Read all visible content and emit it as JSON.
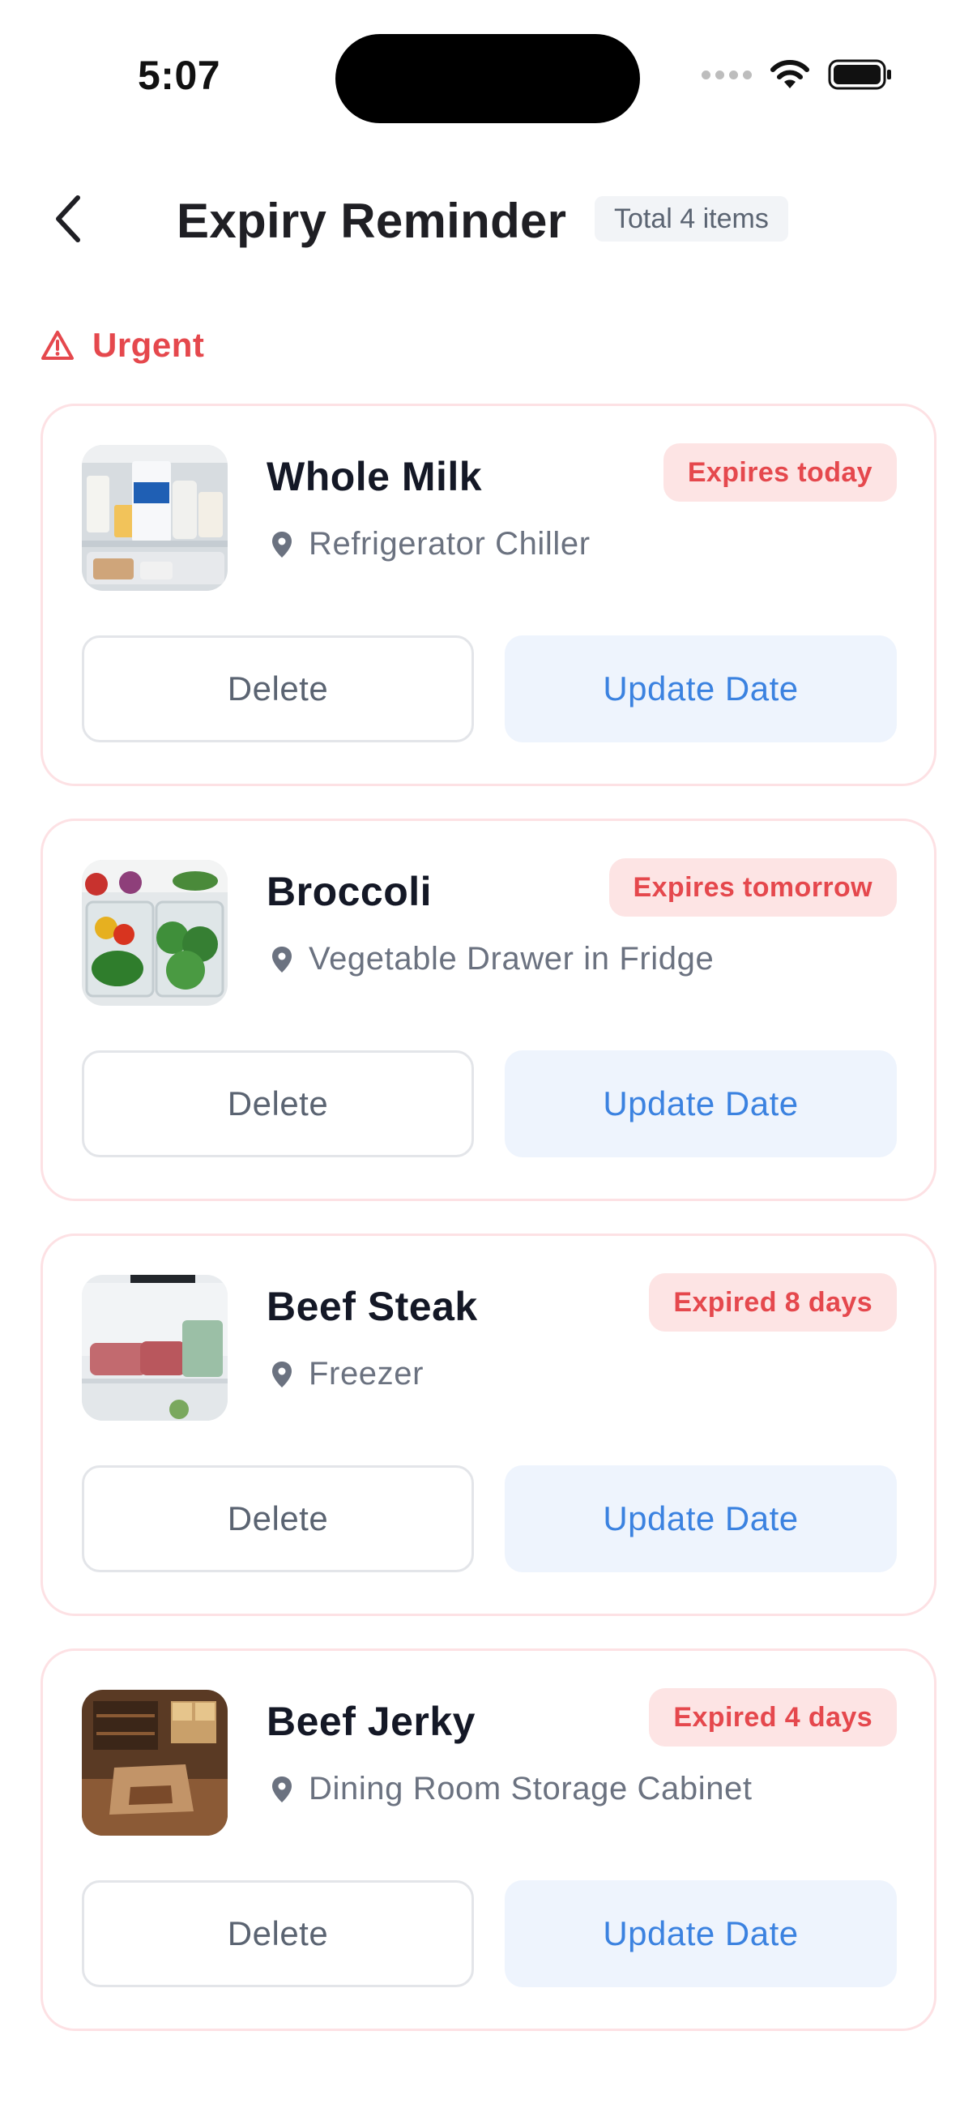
{
  "status": {
    "time": "5:07"
  },
  "header": {
    "title": "Expiry Reminder",
    "count": "Total 4 items"
  },
  "section": {
    "label": "Urgent"
  },
  "colors": {
    "urgent": "#e5484d",
    "accent": "#3b82e0",
    "badge_bg": "#fde4e4"
  },
  "items": [
    {
      "name": "Whole Milk",
      "location": "Refrigerator Chiller",
      "expiry": "Expires today",
      "delete_label": "Delete",
      "update_label": "Update Date",
      "image": "fridge-dairy-image"
    },
    {
      "name": "Broccoli",
      "location": "Vegetable Drawer in Fridge",
      "expiry": "Expires tomorrow",
      "delete_label": "Delete",
      "update_label": "Update Date",
      "image": "vegetable-drawer-image"
    },
    {
      "name": "Beef Steak",
      "location": "Freezer",
      "expiry": "Expired 8 days",
      "delete_label": "Delete",
      "update_label": "Update Date",
      "image": "freezer-meat-image"
    },
    {
      "name": "Beef Jerky",
      "location": "Dining Room Storage Cabinet",
      "expiry": "Expired 4 days",
      "delete_label": "Delete",
      "update_label": "Update Date",
      "image": "pantry-cabinet-image"
    }
  ]
}
